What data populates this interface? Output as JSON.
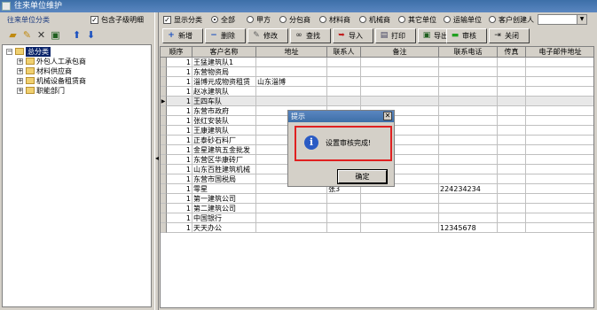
{
  "window": {
    "title": "往来单位维护"
  },
  "left_panel": {
    "title": "往来单位分类",
    "include_children_label": "包含子级明细",
    "include_children_checked": true,
    "toolbar_icons": [
      "add-folder-icon",
      "edit-icon",
      "delete-icon",
      "export-icon",
      "arrow-up-icon",
      "arrow-down-icon"
    ],
    "tree": {
      "root": "总分类",
      "children": [
        "外包人工承包商",
        "材料供应商",
        "机械设备租赁商",
        "职能部门"
      ]
    }
  },
  "filter": {
    "show_category_label": "显示分类",
    "show_category_checked": true,
    "options": [
      {
        "label": "全部",
        "selected": true
      },
      {
        "label": "甲方",
        "selected": false
      },
      {
        "label": "分包商",
        "selected": false
      },
      {
        "label": "材料商",
        "selected": false
      },
      {
        "label": "机械商",
        "selected": false
      },
      {
        "label": "其它单位",
        "selected": false
      },
      {
        "label": "运输单位",
        "selected": false
      },
      {
        "label": "客户",
        "selected": false
      }
    ],
    "creator_label": "创建人",
    "creator_value": ""
  },
  "toolbar": {
    "buttons": [
      {
        "label": "新增",
        "icon": "plus-icon"
      },
      {
        "label": "删除",
        "icon": "minus-icon"
      },
      {
        "label": "修改",
        "icon": "edit-icon"
      },
      {
        "label": "查找",
        "icon": "binoculars-icon"
      },
      {
        "label": "导入",
        "icon": "import-icon"
      },
      {
        "label": "打印",
        "icon": "printer-icon"
      },
      {
        "label": "导出",
        "icon": "export-icon"
      },
      {
        "label": "审核",
        "icon": "approve-icon"
      },
      {
        "label": "关闭",
        "icon": "close-icon"
      }
    ]
  },
  "grid": {
    "columns": [
      "顺序",
      "客户名称",
      "地址",
      "联系人",
      "备注",
      "联系电话",
      "传真",
      "电子邮件地址"
    ],
    "current_row": 4,
    "rows": [
      [
        "1",
        "王猛建筑队1",
        "",
        "",
        "",
        "",
        "",
        ""
      ],
      [
        "1",
        "东营物资局",
        "",
        "",
        "",
        "",
        "",
        ""
      ],
      [
        "1",
        "淄博元成物资租赁",
        "山东淄博",
        "",
        "",
        "",
        "",
        ""
      ],
      [
        "1",
        "赵冰建筑队",
        "",
        "",
        "",
        "",
        "",
        ""
      ],
      [
        "1",
        "王四车队",
        "",
        "",
        "",
        "",
        "",
        ""
      ],
      [
        "1",
        "东营市政府",
        "",
        "",
        "",
        "",
        "",
        ""
      ],
      [
        "1",
        "张红安装队",
        "",
        "",
        "",
        "",
        "",
        ""
      ],
      [
        "1",
        "王康建筑队",
        "",
        "",
        "",
        "",
        "",
        ""
      ],
      [
        "1",
        "正泰砂石料厂",
        "",
        "",
        "",
        "",
        "",
        ""
      ],
      [
        "1",
        "金星建筑五金批发",
        "",
        "",
        "",
        "",
        "",
        ""
      ],
      [
        "1",
        "东营区华康砖厂",
        "",
        "",
        "",
        "",
        "",
        ""
      ],
      [
        "1",
        "山东百胜建筑机械",
        "",
        "",
        "",
        "",
        "",
        ""
      ],
      [
        "1",
        "东营市国税局",
        "",
        "",
        "",
        "",
        "",
        ""
      ],
      [
        "1",
        "零星",
        "",
        "张3",
        "",
        "224234234",
        "",
        ""
      ],
      [
        "1",
        "第一建筑公司",
        "",
        "",
        "",
        "",
        "",
        ""
      ],
      [
        "1",
        "第二建筑公司",
        "",
        "",
        "",
        "",
        "",
        ""
      ],
      [
        "1",
        "中国银行",
        "",
        "",
        "",
        "",
        "",
        ""
      ],
      [
        "1",
        "天天办公",
        "",
        "",
        "",
        "12345678",
        "",
        ""
      ]
    ]
  },
  "dialog": {
    "title": "提示",
    "icon": "info-icon",
    "message": "设置审核完成!",
    "ok_label": "确定",
    "close_glyph": "✕",
    "highlight_color": "#e02020"
  }
}
